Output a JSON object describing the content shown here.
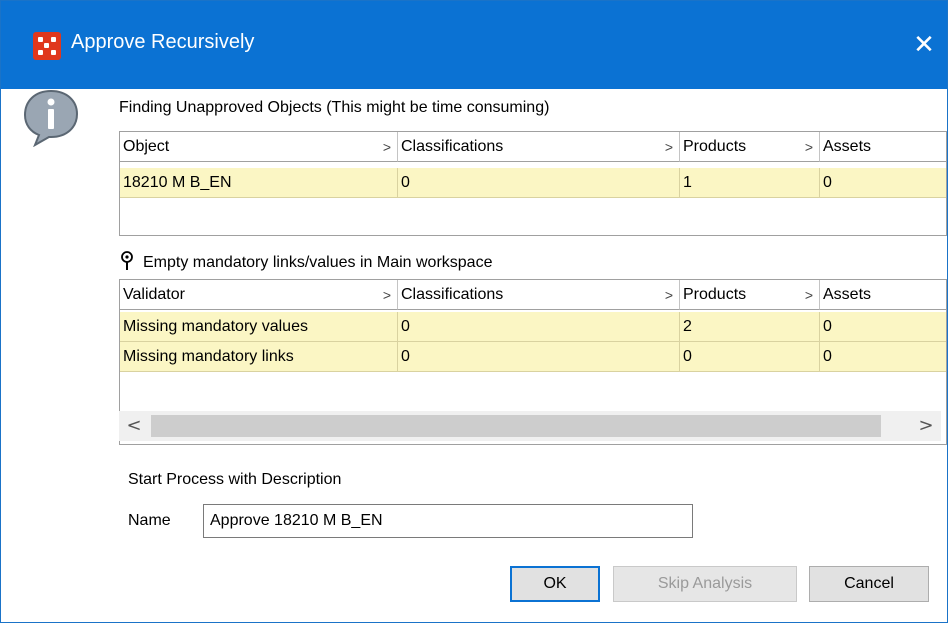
{
  "window": {
    "title": "Approve Recursively",
    "close_glyph": "✕"
  },
  "icons": {
    "app": "app-grid-icon",
    "info": "info-icon",
    "pin": "pin-icon"
  },
  "objects_section": {
    "label": "Finding Unapproved Objects (This might be time consuming)",
    "columns": [
      "Object",
      "Classifications",
      "Products",
      "Assets"
    ],
    "rows": [
      [
        "18210 M B_EN",
        "0",
        "1",
        "0"
      ]
    ]
  },
  "validators_section": {
    "label": "Empty mandatory links/values in Main workspace",
    "columns": [
      "Validator",
      "Classifications",
      "Products",
      "Assets"
    ],
    "rows": [
      [
        "Missing mandatory values",
        "0",
        "2",
        "0"
      ],
      [
        "Missing mandatory links",
        "0",
        "0",
        "0"
      ]
    ]
  },
  "column_chevron": ">",
  "scrollbar": {
    "left_arrow": "<",
    "right_arrow": ">"
  },
  "process": {
    "label": "Start Process with Description",
    "name_label": "Name",
    "name_value": "Approve 18210 M B_EN"
  },
  "buttons": {
    "ok": "OK",
    "skip": "Skip Analysis",
    "cancel": "Cancel"
  },
  "colors": {
    "titlebar": "#0b72d3",
    "row_highlight": "#fbf6c4",
    "app_icon": "#e0371d"
  }
}
